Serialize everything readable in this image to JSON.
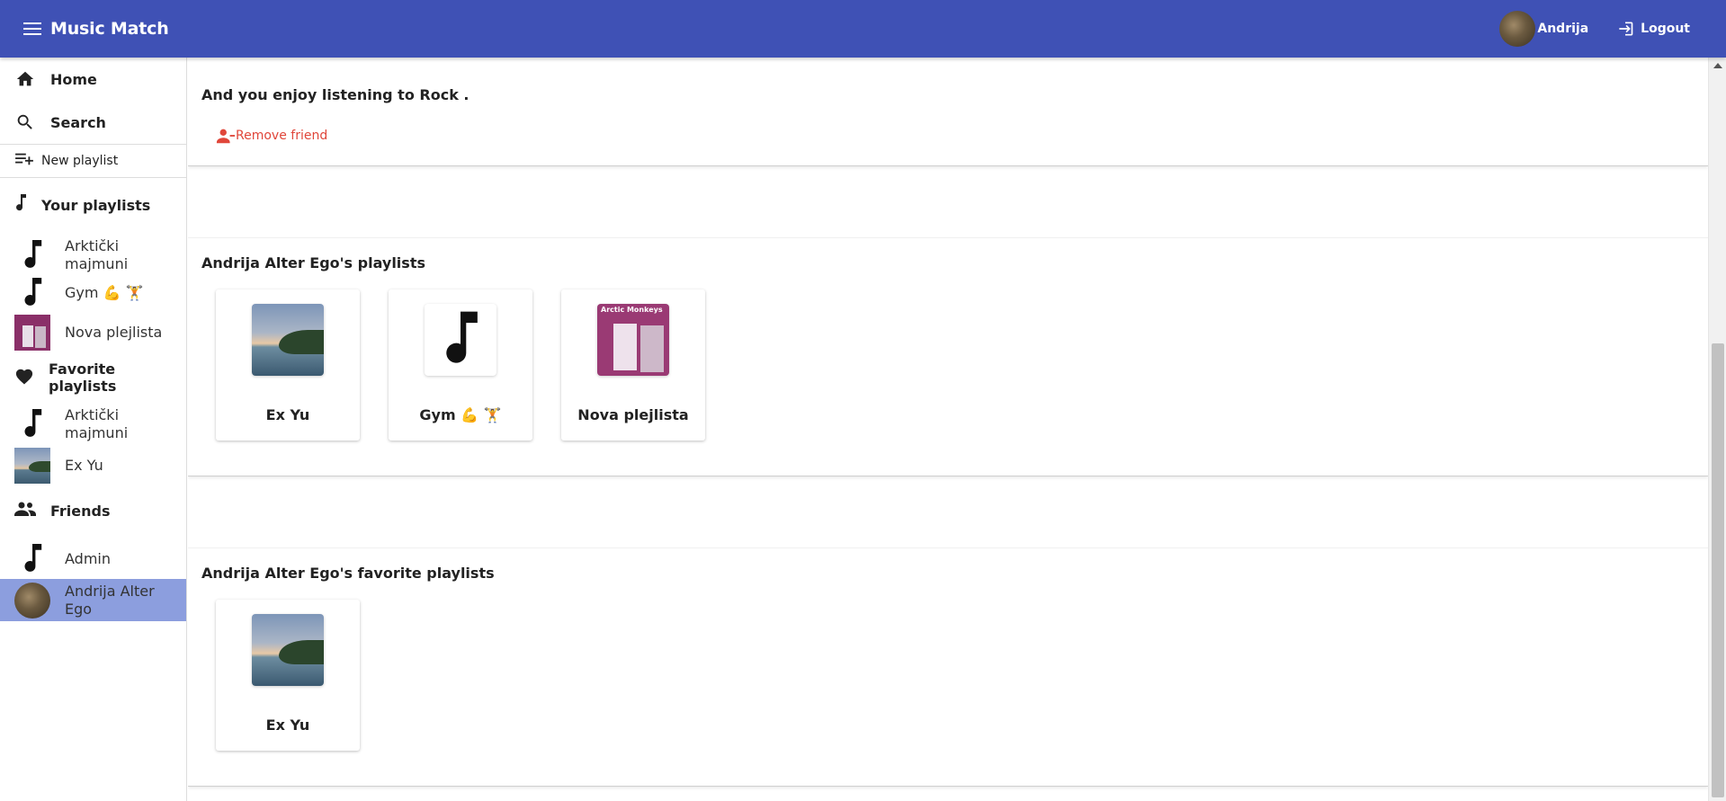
{
  "topbar": {
    "title": "Music Match",
    "user_name": "Andrija",
    "logout_label": "Logout"
  },
  "sidebar": {
    "home_label": "Home",
    "search_label": "Search",
    "new_playlist_label": "New playlist",
    "your_playlists_label": "Your playlists",
    "your_playlists": [
      {
        "label": "Arktički majmuni",
        "thumb": "music-note"
      },
      {
        "label": "Gym 💪 🏋",
        "thumb": "music-note"
      },
      {
        "label": "Nova plejlista",
        "thumb": "album-cover"
      }
    ],
    "favorite_playlists_label": "Favorite playlists",
    "favorite_playlists": [
      {
        "label": "Arktički majmuni",
        "thumb": "music-note"
      },
      {
        "label": "Ex Yu",
        "thumb": "sea-photo"
      }
    ],
    "friends_label": "Friends",
    "friends": [
      {
        "label": "Admin",
        "thumb": "music-note"
      },
      {
        "label": "Andrija Alter Ego",
        "thumb": "avatar",
        "selected": true
      }
    ]
  },
  "main": {
    "enjoy_text": "And you enjoy listening to Rock .",
    "remove_friend_label": "Remove friend",
    "playlists_title": "Andrija Alter Ego's playlists",
    "playlists": [
      {
        "name": "Ex Yu",
        "art": "sea-photo"
      },
      {
        "name": "Gym 💪 🏋",
        "art": "music-note"
      },
      {
        "name": "Nova plejlista",
        "art": "album-cover",
        "art_text": "Arctic Monkeys"
      }
    ],
    "favorites_title": "Andrija Alter Ego's favorite playlists",
    "favorites": [
      {
        "name": "Ex Yu",
        "art": "sea-photo"
      }
    ]
  },
  "colors": {
    "topbar": "#3f51b5",
    "selected": "#8c9ede",
    "danger": "#e0463a"
  }
}
